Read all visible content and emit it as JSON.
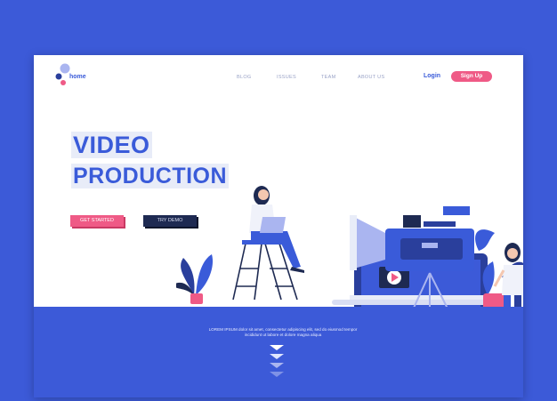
{
  "brand": {
    "name": "home"
  },
  "nav": {
    "items": [
      {
        "label": "BLOG"
      },
      {
        "label": "ISSUES"
      },
      {
        "label": "TEAM"
      },
      {
        "label": "ABOUT US"
      }
    ],
    "login": "Login",
    "signup": "Sign Up"
  },
  "hero": {
    "title_line1": "VIDEO",
    "title_line2": "PRODUCTION",
    "primary_button": "GET STARTED",
    "secondary_button": "TRY DEMO"
  },
  "footer": {
    "text_line1": "LOREM IPSUM dolor sit amet, consectetur adipiscing elit, sed do eiusmod tempor",
    "text_line2": "incididunt ut labore et dolore magna aliqua"
  },
  "colors": {
    "accent": "#3a5bd9",
    "pink": "#ef5a86",
    "dark": "#1e2a52",
    "background": "#3c5ad8"
  },
  "icons": [
    "logo-icon",
    "play-icon",
    "video-camera-icon",
    "arrow-down-icon"
  ]
}
